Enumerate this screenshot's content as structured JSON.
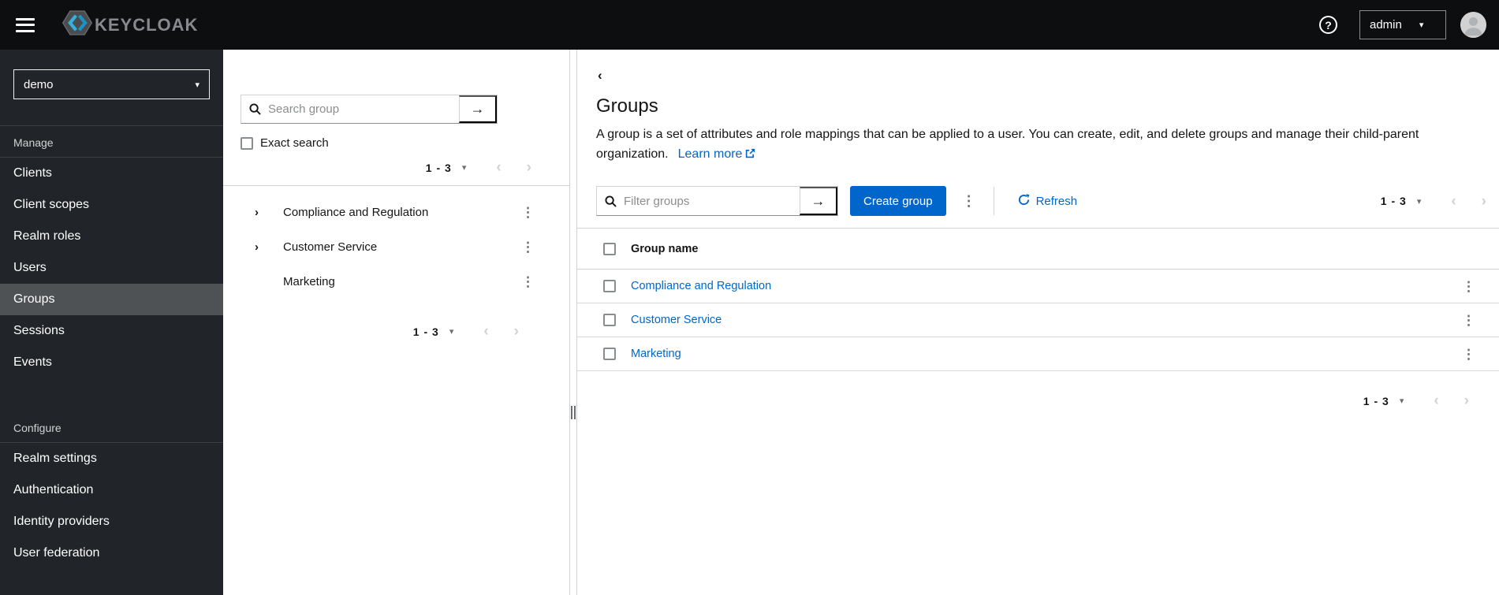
{
  "masthead": {
    "brand": "KEYCLOAK",
    "user": "admin"
  },
  "icons": {
    "help": "?",
    "caret_down": "▾",
    "arrow_right": "→",
    "kebab": "⋮",
    "chevron_left": "‹",
    "chevron_right": "›",
    "expand": "›",
    "back": "‹"
  },
  "sidebar": {
    "realm": "demo",
    "manage": {
      "label": "Manage",
      "items": [
        "Clients",
        "Client scopes",
        "Realm roles",
        "Users",
        "Groups",
        "Sessions",
        "Events"
      ]
    },
    "configure": {
      "label": "Configure",
      "items": [
        "Realm settings",
        "Authentication",
        "Identity providers",
        "User federation"
      ]
    },
    "selected_item": "Groups"
  },
  "tree": {
    "search_placeholder": "Search group",
    "exact_search_label": "Exact search",
    "pagination_top": {
      "range": "1 - 3"
    },
    "pagination_bottom": {
      "range": "1 - 3"
    },
    "items": [
      {
        "label": "Compliance and Regulation",
        "expandable": true
      },
      {
        "label": "Customer Service",
        "expandable": true
      },
      {
        "label": "Marketing",
        "expandable": false
      }
    ]
  },
  "main": {
    "title": "Groups",
    "description": "A group is a set of attributes and role mappings that can be applied to a user. You can create, edit, and delete groups and manage their child-parent organization.",
    "learn_more_label": "Learn more",
    "toolbar": {
      "filter_placeholder": "Filter groups",
      "create_button_label": "Create group",
      "refresh_label": "Refresh",
      "pagination": {
        "range": "1 - 3"
      }
    },
    "table": {
      "column_header": "Group name",
      "rows": [
        {
          "name": "Compliance and Regulation"
        },
        {
          "name": "Customer Service"
        },
        {
          "name": "Marketing"
        }
      ]
    },
    "pagination_bottom": {
      "range": "1 - 3"
    }
  },
  "colors": {
    "primary": "#0066cc",
    "link": "#0066cc",
    "masthead_bg": "#0d0e10",
    "sidebar_bg": "#212529",
    "selected_nav_bg": "#4f5255",
    "logo_blue": "#35b1dd"
  }
}
